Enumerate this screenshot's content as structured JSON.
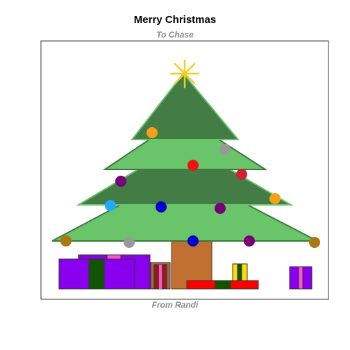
{
  "title": "Merry Christmas",
  "subtitle": "To Chase",
  "caption": "From Randi",
  "colors": {
    "frame": "#333333",
    "tree_dark": "#437c44",
    "tree_light": "#6ac46a",
    "tree_outline": "#3a7a3a",
    "trunk": "#c07030",
    "star": "#f5cc1a",
    "ornament_orange": "#f6a01a",
    "ornament_gray": "#999999",
    "ornament_red": "#ee1111",
    "ornament_crimson": "#cc2233",
    "ornament_purple": "#770077",
    "ornament_blue": "#0000cc",
    "ornament_cyan": "#22aaff",
    "ornament_gold": "#aa7711",
    "gift_purple": "#8800ee",
    "gift_green": "#115500",
    "gift_pink": "#ff55cc",
    "gift_red": "#ff0000",
    "gift_yellow": "#ffdd00",
    "gift_maroon": "#882222"
  },
  "ornaments": [
    "orange",
    "gray",
    "red",
    "crimson",
    "purple",
    "cyan",
    "blue",
    "purple",
    "orange",
    "gold",
    "gray",
    "blue",
    "purple",
    "gold"
  ],
  "gifts": [
    "purple-large",
    "purple-back",
    "maroon-small",
    "red-long",
    "yellow-small",
    "purple-right"
  ]
}
